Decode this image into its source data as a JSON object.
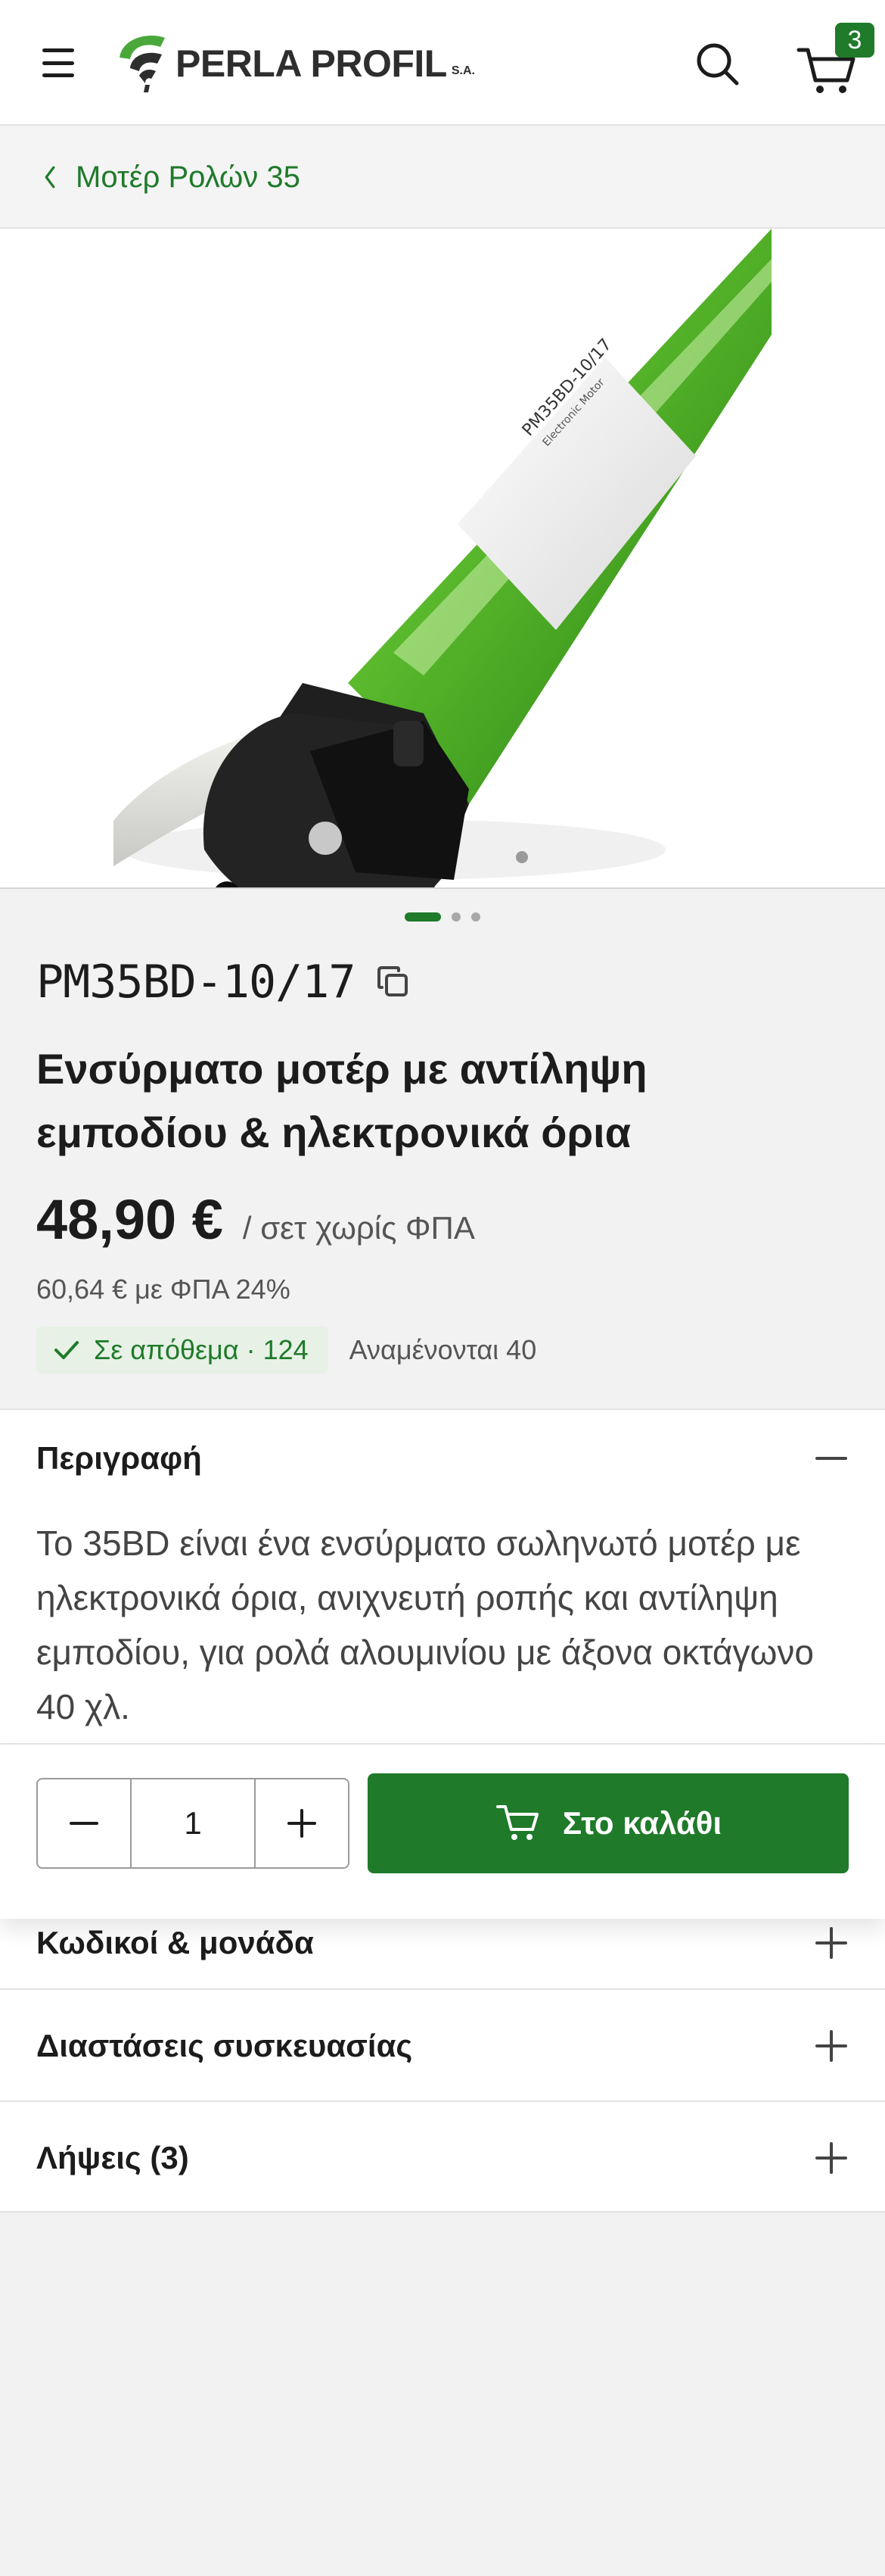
{
  "header": {
    "logo_text": "PERLA PROFIL",
    "logo_suffix": "S.A.",
    "cart_count": "3"
  },
  "breadcrumb": {
    "label": "Μοτέρ Ρολών 35"
  },
  "gallery": {
    "slides": 3,
    "active_slide": 1,
    "label_line1": "PM35BD-10/17",
    "label_line2": "Electronic Motor"
  },
  "product": {
    "sku": "PM35BD-10/17",
    "title": "Ενσύρματο μοτέρ με αντίληψη εμποδίου & ηλεκτρονικά όρια",
    "price": "48,90 €",
    "price_unit": "/ σετ χωρίς ΦΠΑ",
    "price_vat": "60,64 € με ΦΠΑ 24%",
    "stock_label": "Σε απόθεμα · 124",
    "expected_label": "Αναμένονται 40"
  },
  "sections": {
    "description": {
      "title": "Περιγραφή",
      "text": "Το 35BD είναι ένα ενσύρματο σωληνωτό μοτέρ με ηλεκτρονικά όρια, ανιχνευτή ροπής και αντίληψη εμποδίου, για ρολά αλουμινίου με άξονα οκτάγωνο 40 χλ."
    },
    "codes": {
      "title": "Κωδικοί & μονάδα"
    },
    "dimensions": {
      "title": "Διαστάσεις συσκευασίας"
    },
    "downloads": {
      "title": "Λήψεις (3)"
    }
  },
  "cart_bar": {
    "quantity": "1",
    "add_label": "Στο καλάθι"
  },
  "colors": {
    "brand_green": "#1f7a2a",
    "stock_bg": "#e7f1e6",
    "motor_green": "#55b52a"
  }
}
